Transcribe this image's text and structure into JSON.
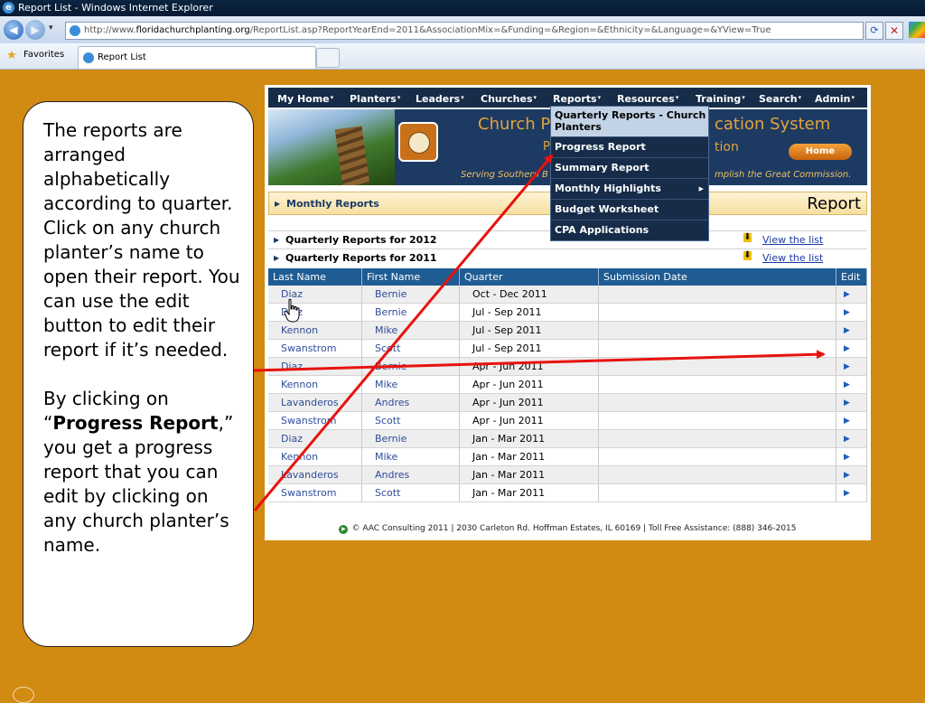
{
  "browser": {
    "window_title": "Report List - Windows Internet Explorer",
    "url_prefix": "http://www.",
    "url_domain": "floridachurchplanting.org",
    "url_path": "/ReportList.asp?ReportYearEnd=2011&AssociationMix=&Funding=&Region=&Ethnicity=&Language=&YView=True",
    "favorites_label": "Favorites",
    "tab_title": "Report List"
  },
  "callout": {
    "para1": "The reports are arranged alphabetically according to quarter.  Click on any church planter’s name to open their report.  You can use the edit button to edit their report if it’s needed.",
    "para2_pre": "By clicking on “",
    "para2_bold": "Progress Report",
    "para2_post": ",” you get a progress report that you can edit by clicking on any church planter’s name."
  },
  "nav": {
    "items": [
      {
        "label": "My Home"
      },
      {
        "label": "Planters"
      },
      {
        "label": "Leaders"
      },
      {
        "label": "Churches"
      },
      {
        "label": "Reports"
      },
      {
        "label": "Resources"
      },
      {
        "label": "Training"
      },
      {
        "label": "Search"
      },
      {
        "label": "Admin"
      }
    ],
    "caret": "▾"
  },
  "banner": {
    "title_left": "Church P",
    "title_right": "cation System",
    "sub_left": "P",
    "sub_right": "tion",
    "tagline_left": "Serving Southern B",
    "tagline_right": "mplish the Great Commission.",
    "home_button": "Home"
  },
  "dropdown": {
    "items": [
      {
        "label": "Quarterly Reports - Church Planters"
      },
      {
        "label": "Progress Report"
      },
      {
        "label": "Summary Report"
      },
      {
        "label": "Monthly Highlights"
      },
      {
        "label": "Budget Worksheet"
      },
      {
        "label": "CPA Applications"
      }
    ]
  },
  "page": {
    "section_title": "Monthly Reports",
    "report_heading": "Report",
    "quarter_groups": [
      {
        "label": "Quarterly Reports for 2012",
        "link": "View the list"
      },
      {
        "label": "Quarterly Reports for 2011",
        "link": "View the list"
      }
    ]
  },
  "table": {
    "headers": [
      "Last Name",
      "First Name",
      "Quarter",
      "Submission Date",
      "Edit"
    ],
    "rows": [
      {
        "last": "Diaz",
        "first": "Bernie",
        "quarter": "Oct - Dec 2011",
        "date": ""
      },
      {
        "last": "Diaz",
        "first": "Bernie",
        "quarter": "Jul - Sep 2011",
        "date": ""
      },
      {
        "last": "Kennon",
        "first": "Mike",
        "quarter": "Jul - Sep 2011",
        "date": ""
      },
      {
        "last": "Swanstrom",
        "first": "Scott",
        "quarter": "Jul - Sep 2011",
        "date": ""
      },
      {
        "last": "Diaz",
        "first": "Bernie",
        "quarter": "Apr - Jun 2011",
        "date": ""
      },
      {
        "last": "Kennon",
        "first": "Mike",
        "quarter": "Apr - Jun 2011",
        "date": ""
      },
      {
        "last": "Lavanderos",
        "first": "Andres",
        "quarter": "Apr - Jun 2011",
        "date": ""
      },
      {
        "last": "Swanstrom",
        "first": "Scott",
        "quarter": "Apr - Jun 2011",
        "date": ""
      },
      {
        "last": "Diaz",
        "first": "Bernie",
        "quarter": "Jan - Mar 2011",
        "date": ""
      },
      {
        "last": "Kennon",
        "first": "Mike",
        "quarter": "Jan - Mar 2011",
        "date": ""
      },
      {
        "last": "Lavanderos",
        "first": "Andres",
        "quarter": "Jan - Mar 2011",
        "date": ""
      },
      {
        "last": "Swanstrom",
        "first": "Scott",
        "quarter": "Jan - Mar 2011",
        "date": ""
      }
    ],
    "edit_glyph": "▶"
  },
  "footer": {
    "text": "© AAC Consulting 2011 | 2030 Carleton Rd. Hoffman Estates, IL 60169 | Toll Free Assistance: (888) 346-2015"
  },
  "colors": {
    "background": "#d18a12",
    "nav_bg": "#162c48",
    "table_header": "#1f5c93",
    "arrow": "#e8120e"
  }
}
